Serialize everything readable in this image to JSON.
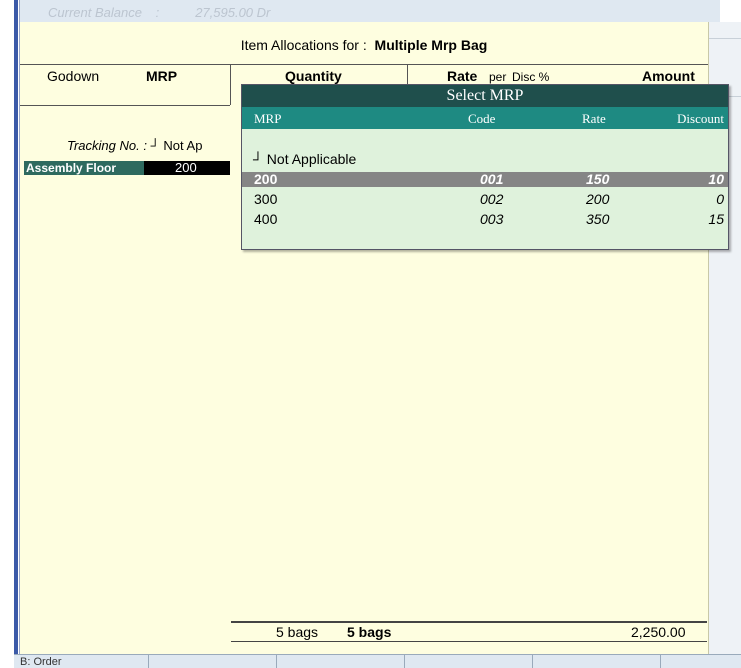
{
  "top": {
    "balance_label": "Current Balance",
    "balance_sep": ":",
    "balance_value": "27,595.00 Dr"
  },
  "title": {
    "prefix": "Item Allocations for :",
    "item": "Multiple Mrp Bag"
  },
  "columns": {
    "godown": "Godown",
    "mrp": "MRP",
    "quantity": "Quantity",
    "rate": "Rate",
    "per": "per",
    "disc": "Disc %",
    "amount": "Amount"
  },
  "tracking": {
    "label": "Tracking No. :",
    "value": "┘ Not Ap"
  },
  "row": {
    "godown": "Assembly Floor",
    "mrp": "200"
  },
  "footer": {
    "qty": "5 bags",
    "billed_qty": "5 bags",
    "amount": "2,250.00"
  },
  "bottom_bar": {
    "first_label": "B: Order"
  },
  "popup": {
    "title": "Select MRP",
    "headers": {
      "mrp": "MRP",
      "code": "Code",
      "rate": "Rate",
      "discount": "Discount"
    },
    "not_applicable": "┘  Not Applicable",
    "rows": [
      {
        "mrp": "200",
        "code": "001",
        "rate": "150",
        "discount": "10",
        "selected": true
      },
      {
        "mrp": "300",
        "code": "002",
        "rate": "200",
        "discount": "0",
        "selected": false
      },
      {
        "mrp": "400",
        "code": "003",
        "rate": "350",
        "discount": "15",
        "selected": false
      }
    ]
  },
  "colors": {
    "popup_title_bg": "#1f4f4c",
    "popup_header_bg": "#1e8a82",
    "selected_row_bg": "#858585",
    "panel_bg": "#fefee0",
    "godown_cell_bg": "#2e6a5f"
  }
}
